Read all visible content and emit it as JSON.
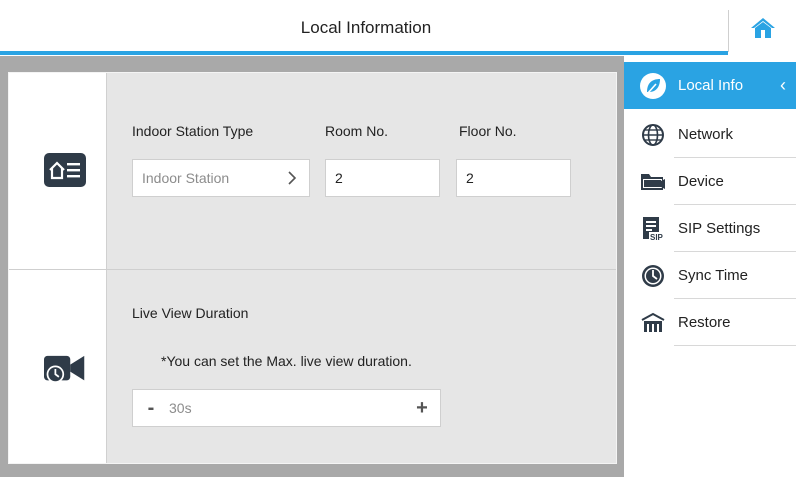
{
  "header": {
    "title": "Local Information"
  },
  "colors": {
    "accent": "#2aa3e3",
    "main_bg": "#a9a9a9",
    "panel_bg": "#e6e6e6",
    "icon_dark": "#2f3b48"
  },
  "icons": {
    "home": "home-icon",
    "local_info": "leaf-icon",
    "network": "globe-icon",
    "device": "folder-icon",
    "sip": "sip-document-icon",
    "sync_time": "clock-icon",
    "restore": "factory-icon"
  },
  "station": {
    "type_label": "Indoor Station Type",
    "type_value": "Indoor Station",
    "room_label": "Room No.",
    "room_value": "2",
    "floor_label": "Floor No.",
    "floor_value": "2"
  },
  "live_view": {
    "label": "Live View Duration",
    "note": "*You can set the Max. live view duration.",
    "value": "30s",
    "minus": "-",
    "plus": "+"
  },
  "sidebar": {
    "items": [
      {
        "label": "Local Info",
        "active": true
      },
      {
        "label": "Network"
      },
      {
        "label": "Device"
      },
      {
        "label": "SIP Settings"
      },
      {
        "label": "Sync Time"
      },
      {
        "label": "Restore"
      }
    ]
  }
}
